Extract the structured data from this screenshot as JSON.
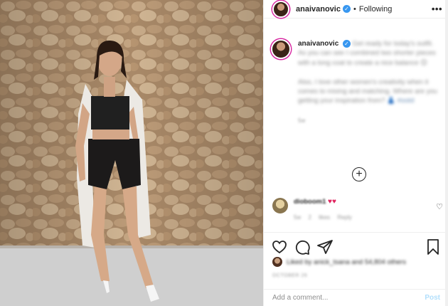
{
  "header": {
    "username": "anaivanovic",
    "separator": "•",
    "follow_status": "Following",
    "more_label": "•••"
  },
  "caption": {
    "username": "anaivanovic",
    "text_part1": "Get ready for today's outfit. As you can see I combined two shorter pieces with a long coat to create a nice balance 😊",
    "text_part2": "Also, I love other women's creativity when it comes to mixing and matching. Where are you getting your inspiration from? 👗 ",
    "hashtag": "#ootd",
    "age": "5w"
  },
  "load_more": "+",
  "comment": {
    "username": "dioboom1",
    "hearts": "♥♥",
    "age": "5w",
    "likes": "2 likes",
    "reply": "Reply"
  },
  "likes": {
    "text": "Liked by anick_tsana and 54,804 others"
  },
  "timestamp": "OCTOBER 26",
  "add_comment": {
    "placeholder": "Add a comment...",
    "post_label": "Post"
  },
  "colors": {
    "accent": "#3897f0",
    "post_disabled": "#b2dffc",
    "ring": "#d6249f"
  }
}
